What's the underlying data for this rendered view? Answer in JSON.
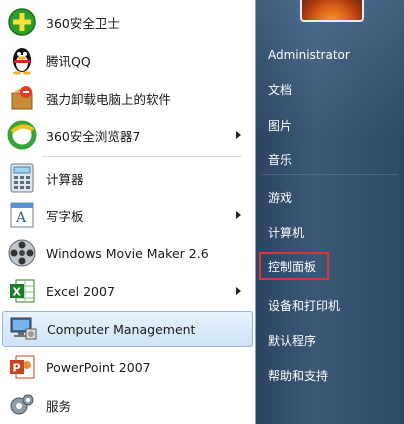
{
  "programs": [
    {
      "label": "360安全卫士",
      "icon": "360-safe-icon",
      "submenu": false
    },
    {
      "label": "腾讯QQ",
      "icon": "qq-penguin-icon",
      "submenu": false
    },
    {
      "label": "强力卸载电脑上的软件",
      "icon": "uninstall-box-icon",
      "submenu": false
    },
    {
      "label": "360安全浏览器7",
      "icon": "360-browser-icon",
      "submenu": true
    },
    {
      "label": "计算器",
      "icon": "calculator-icon",
      "submenu": false
    },
    {
      "label": "写字板",
      "icon": "wordpad-icon",
      "submenu": true
    },
    {
      "label": "Windows Movie Maker 2.6",
      "icon": "film-reel-icon",
      "submenu": false
    },
    {
      "label": "Excel 2007",
      "icon": "excel-icon",
      "submenu": true
    },
    {
      "label": "Computer Management",
      "icon": "computer-management-icon",
      "submenu": false,
      "selected": true
    },
    {
      "label": "PowerPoint 2007",
      "icon": "powerpoint-icon",
      "submenu": false
    },
    {
      "label": "服务",
      "icon": "services-gear-icon",
      "submenu": false
    }
  ],
  "right_menu": [
    {
      "label": "Administrator"
    },
    {
      "label": "文档"
    },
    {
      "label": "图片"
    },
    {
      "label": "音乐"
    },
    {
      "label": "游戏"
    },
    {
      "label": "计算机"
    },
    {
      "label": "控制面板",
      "highlighted": true
    },
    {
      "label": "设备和打印机"
    },
    {
      "label": "默认程序"
    },
    {
      "label": "帮助和支持"
    }
  ],
  "colors": {
    "highlight_border": "#e0303a",
    "right_panel": "#3b5876",
    "selection": "#cfe3f8"
  }
}
